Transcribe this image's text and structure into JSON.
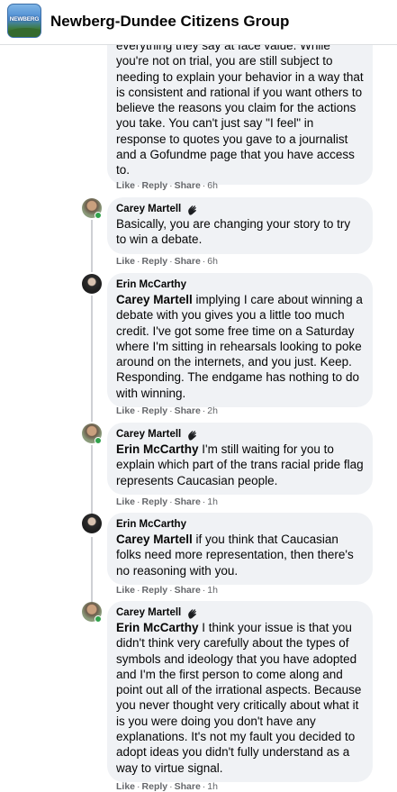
{
  "header": {
    "logo_text": "NEWBERG",
    "title": "Newberg-Dundee Citizens Group"
  },
  "actions": {
    "like": "Like",
    "reply": "Reply",
    "share": "Share",
    "dot": "·"
  },
  "comments": [
    {
      "author": "",
      "text": "everything they say at face value. While you're not on trial, you are still subject to needing to explain your behavior in a way that is consistent and rational if you want others to believe the reasons you claim for the actions you take. You can't just say \"I feel\" in response to quotes you gave to a journalist and a Gofundme page that you have access to.",
      "time": "6h"
    },
    {
      "author": "Carey Martell",
      "mention": "",
      "text": "Basically, you are changing your story to try to win a debate.",
      "time": "6h"
    },
    {
      "author": "Erin McCarthy",
      "mention": "Carey Martell",
      "text": " implying I care about winning a debate with you gives you a little too much credit. I've got some free time on a Saturday where I'm sitting in rehearsals looking to poke around on the internets, and you just. Keep. Responding. The endgame has nothing to do with winning.",
      "time": "2h"
    },
    {
      "author": "Carey Martell",
      "mention": "Erin McCarthy",
      "text": " I'm still waiting for you to explain which part of the trans racial pride flag represents Caucasian people.",
      "time": "1h"
    },
    {
      "author": "Erin McCarthy",
      "mention": "Carey Martell",
      "text": " if you think that Caucasian folks need more representation, then there's no reasoning with you.",
      "time": "1h"
    },
    {
      "author": "Carey Martell",
      "mention": "Erin McCarthy",
      "text": " I think your issue is that you didn't think very carefully about the types of symbols and ideology that you have adopted and I'm the first person to come along and point out all of the irrational aspects. Because you never thought very critically about what it is you were doing you don't have any explanations. It's not my fault you decided to adopt ideas you didn't fully understand as a way to virtue signal.",
      "time": "1h"
    }
  ]
}
